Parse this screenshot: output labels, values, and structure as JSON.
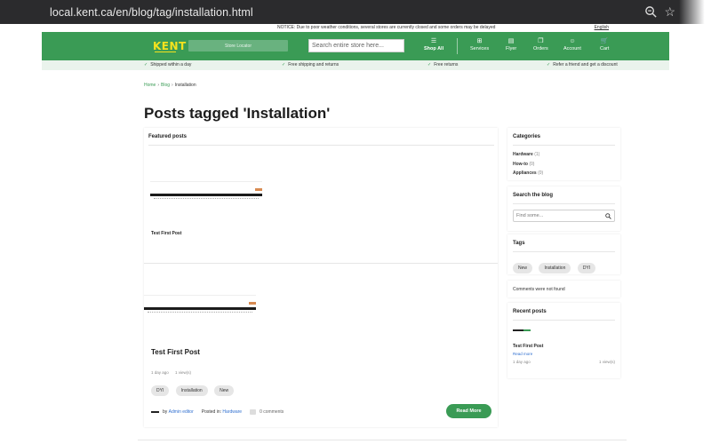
{
  "browser": {
    "url": "local.kent.ca/en/blog/tag/installation.html"
  },
  "notice": {
    "text": "NOTICE: Due to poor weather conditions, several stores are currently closed and some orders may be delayed",
    "language": "English"
  },
  "header": {
    "logo": "KENT",
    "store_locator": "Store Locator",
    "search_placeholder": "Search entire store here...",
    "shop_all": "Shop All",
    "services": "Services",
    "flyer": "Flyer",
    "orders": "Orders",
    "account": "Account",
    "cart": "Cart"
  },
  "benefits": [
    "Shipped within a day",
    "Free shipping and returns",
    "Free returns",
    "Refer a friend and get a discount"
  ],
  "breadcrumb": {
    "home": "Home",
    "blog": "Blog",
    "current": "Installation"
  },
  "page_title": "Posts tagged 'Installation'",
  "featured": {
    "heading": "Featured posts",
    "post_title": "Test First Post"
  },
  "post": {
    "title": "Test First Post",
    "age": "1 day ago",
    "views": "1 view(s)",
    "tags": [
      "DYI",
      "Installation",
      "New"
    ],
    "by_label": "by",
    "author": "Admin editor",
    "posted_in_label": "Posted in:",
    "category": "Hardware",
    "comments": "0 comments",
    "read_more": "Read More"
  },
  "sidebar": {
    "categories_heading": "Categories",
    "categories": [
      {
        "name": "Hardware",
        "count": "(1)"
      },
      {
        "name": "How-to",
        "count": "(0)"
      },
      {
        "name": "Appliances",
        "count": "(0)"
      }
    ],
    "search_heading": "Search the blog",
    "search_placeholder": "Find some...",
    "tags_heading": "Tags",
    "tags": [
      "New",
      "Installation",
      "DYI"
    ],
    "comments_empty": "Comments were not found",
    "recent_heading": "Recent posts",
    "recent_title": "Test First Post",
    "recent_read_more": "Read more",
    "recent_age": "1 day ago",
    "recent_views": "1 view(s)"
  },
  "colors": {
    "brand_green": "#3a9b55",
    "logo_yellow": "#f4e21e"
  }
}
